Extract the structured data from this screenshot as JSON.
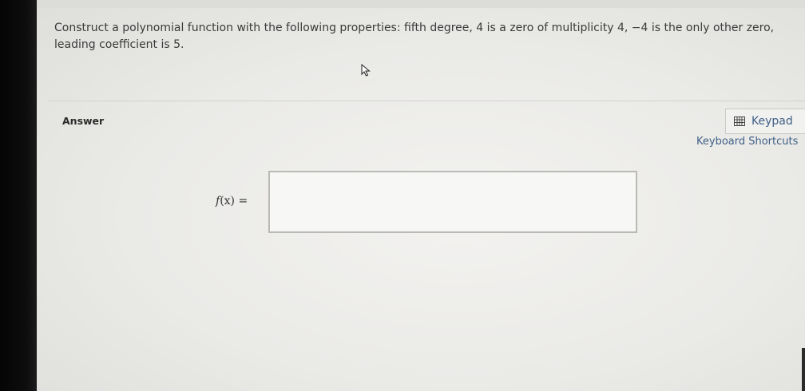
{
  "question": {
    "text": "Construct a polynomial function with the following properties: fifth degree, 4 is a zero of multiplicity 4, −4 is the only other zero, leading coefficient is 5."
  },
  "answer": {
    "label": "Answer",
    "keypad_label": "Keypad",
    "shortcuts_label": "Keyboard Shortcuts",
    "function_name": "f",
    "function_arg": "(x)",
    "equals": " =",
    "input_value": ""
  },
  "icons": {
    "cursor": "mouse-pointer-icon",
    "keypad": "keypad-grid-icon"
  },
  "colors": {
    "link": "#3f5f86",
    "text": "#3a3a3a"
  }
}
